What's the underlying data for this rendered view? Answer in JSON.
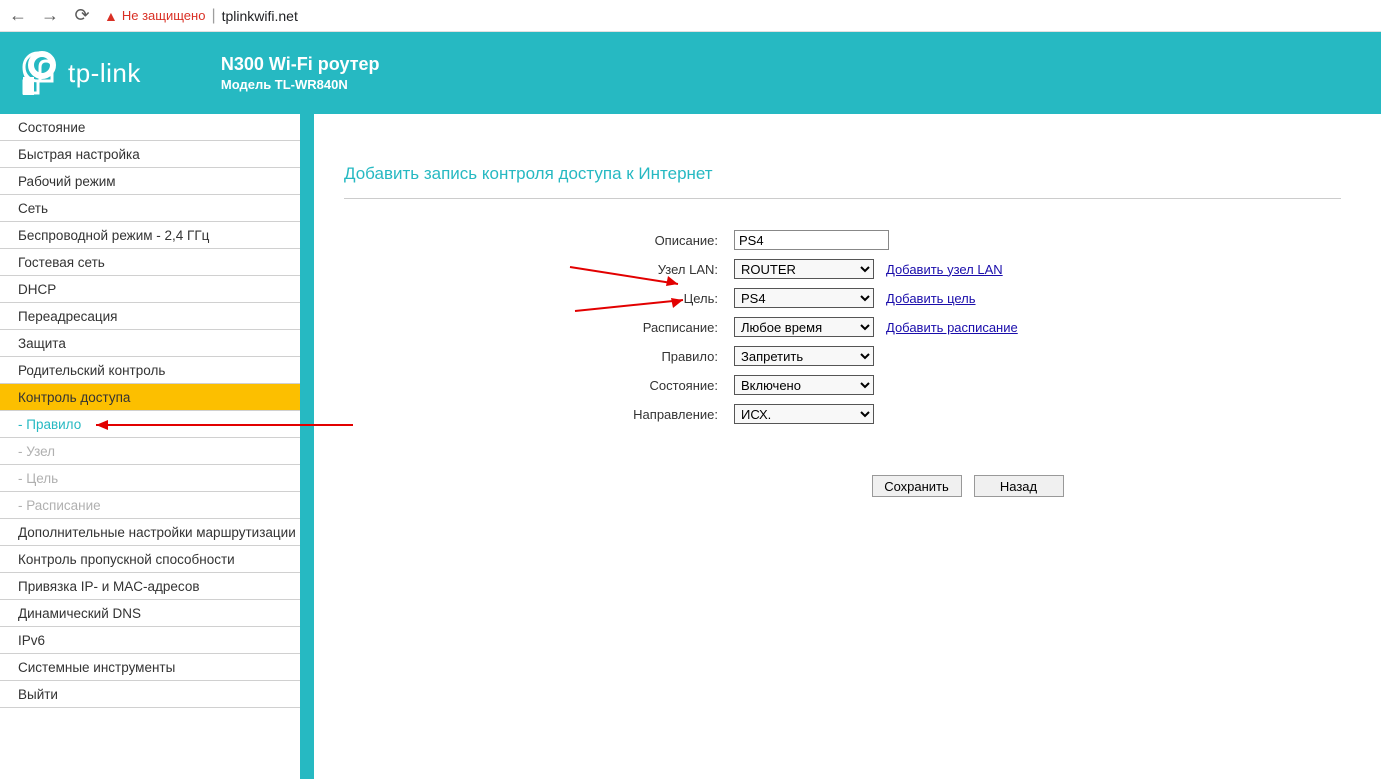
{
  "browser": {
    "security_text": "Не защищено",
    "url": "tplinkwifi.net"
  },
  "header": {
    "logo": "tp-link",
    "product": "N300 Wi-Fi роутер",
    "model": "Модель TL-WR840N"
  },
  "sidebar": {
    "items": [
      {
        "label": "Состояние",
        "type": "normal"
      },
      {
        "label": "Быстрая настройка",
        "type": "normal"
      },
      {
        "label": "Рабочий режим",
        "type": "normal"
      },
      {
        "label": "Сеть",
        "type": "normal"
      },
      {
        "label": "Беспроводной режим - 2,4 ГГц",
        "type": "normal"
      },
      {
        "label": "Гостевая сеть",
        "type": "normal"
      },
      {
        "label": "DHCP",
        "type": "normal"
      },
      {
        "label": "Переадресация",
        "type": "normal"
      },
      {
        "label": "Защита",
        "type": "normal"
      },
      {
        "label": "Родительский контроль",
        "type": "normal"
      },
      {
        "label": "Контроль доступа",
        "type": "active"
      },
      {
        "label": "- Правило",
        "type": "sub-active"
      },
      {
        "label": "- Узел",
        "type": "sub-inactive"
      },
      {
        "label": "- Цель",
        "type": "sub-inactive"
      },
      {
        "label": "- Расписание",
        "type": "sub-inactive"
      },
      {
        "label": "Дополнительные настройки маршрутизации",
        "type": "normal"
      },
      {
        "label": "Контроль пропускной способности",
        "type": "normal"
      },
      {
        "label": "Привязка IP- и MAC-адресов",
        "type": "normal"
      },
      {
        "label": "Динамический DNS",
        "type": "normal"
      },
      {
        "label": "IPv6",
        "type": "normal"
      },
      {
        "label": "Системные инструменты",
        "type": "normal"
      },
      {
        "label": "Выйти",
        "type": "normal"
      }
    ]
  },
  "main": {
    "title": "Добавить запись контроля доступа к Интернет",
    "form": {
      "description": {
        "label": "Описание:",
        "value": "PS4"
      },
      "lan_node": {
        "label": "Узел LAN:",
        "value": "ROUTER",
        "link": "Добавить узел LAN"
      },
      "target": {
        "label": "Цель:",
        "value": "PS4",
        "link": "Добавить цель"
      },
      "schedule": {
        "label": "Расписание:",
        "value": "Любое время",
        "link": "Добавить расписание"
      },
      "rule": {
        "label": "Правило:",
        "value": "Запретить"
      },
      "status": {
        "label": "Состояние:",
        "value": "Включено"
      },
      "direction": {
        "label": "Направление:",
        "value": "ИСХ."
      }
    },
    "buttons": {
      "save": "Сохранить",
      "back": "Назад"
    }
  }
}
